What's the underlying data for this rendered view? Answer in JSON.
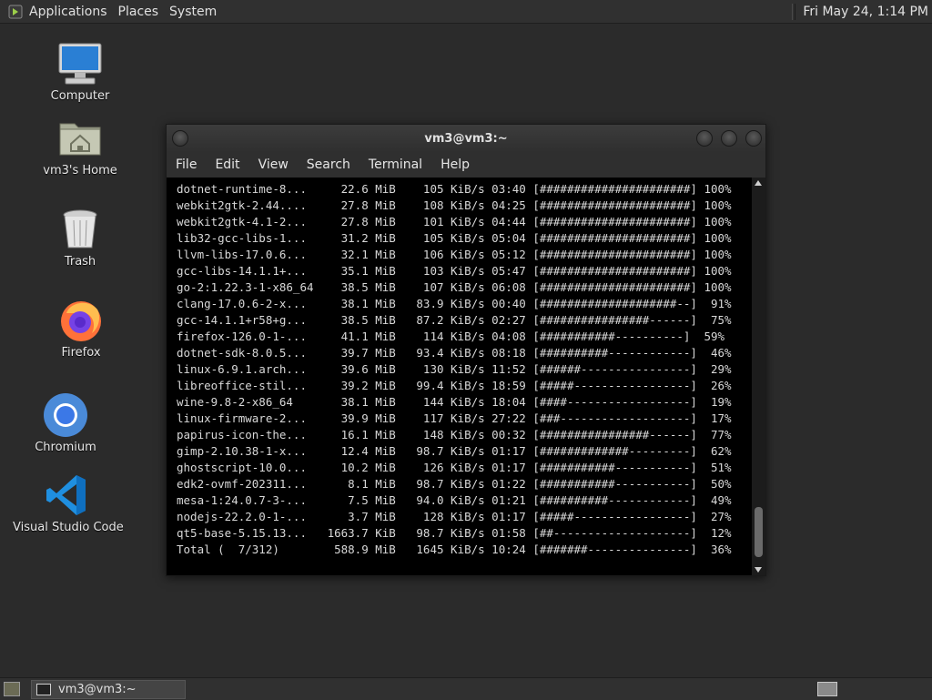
{
  "top_panel": {
    "menus": [
      "Applications",
      "Places",
      "System"
    ],
    "clock": "Fri May 24,  1:14 PM"
  },
  "desktop_icons": [
    {
      "label": "Computer",
      "icon": "computer-monitor-icon"
    },
    {
      "label": "vm3's Home",
      "icon": "home-folder-icon"
    },
    {
      "label": "Trash",
      "icon": "trash-icon"
    },
    {
      "label": "Firefox",
      "icon": "firefox-icon"
    },
    {
      "label": "Chromium",
      "icon": "chromium-icon"
    },
    {
      "label": "Visual Studio Code",
      "icon": "vscode-icon"
    }
  ],
  "window": {
    "title": "vm3@vm3:~",
    "menus": [
      "File",
      "Edit",
      "View",
      "Search",
      "Terminal",
      "Help"
    ]
  },
  "terminal_lines": [
    " dotnet-runtime-8...     22.6 MiB    105 KiB/s 03:40 [######################] 100%",
    " webkit2gtk-2.44....     27.8 MiB    108 KiB/s 04:25 [######################] 100%",
    " webkit2gtk-4.1-2...     27.8 MiB    101 KiB/s 04:44 [######################] 100%",
    " lib32-gcc-libs-1...     31.2 MiB    105 KiB/s 05:04 [######################] 100%",
    " llvm-libs-17.0.6...     32.1 MiB    106 KiB/s 05:12 [######################] 100%",
    " gcc-libs-14.1.1+...     35.1 MiB    103 KiB/s 05:47 [######################] 100%",
    " go-2:1.22.3-1-x86_64    38.5 MiB    107 KiB/s 06:08 [######################] 100%",
    " clang-17.0.6-2-x...     38.1 MiB   83.9 KiB/s 00:40 [####################--]  91%",
    " gcc-14.1.1+r58+g...     38.5 MiB   87.2 KiB/s 02:27 [################------]  75%",
    " firefox-126.0-1-...     41.1 MiB    114 KiB/s 04:08 [###########----------]  59%",
    " dotnet-sdk-8.0.5...     39.7 MiB   93.4 KiB/s 08:18 [##########------------]  46%",
    " linux-6.9.1.arch...     39.6 MiB    130 KiB/s 11:52 [######----------------]  29%",
    " libreoffice-stil...     39.2 MiB   99.4 KiB/s 18:59 [#####-----------------]  26%",
    " wine-9.8-2-x86_64       38.1 MiB    144 KiB/s 18:04 [####------------------]  19%",
    " linux-firmware-2...     39.9 MiB    117 KiB/s 27:22 [###-------------------]  17%",
    " papirus-icon-the...     16.1 MiB    148 KiB/s 00:32 [################------]  77%",
    " gimp-2.10.38-1-x...     12.4 MiB   98.7 KiB/s 01:17 [#############---------]  62%",
    " ghostscript-10.0...     10.2 MiB    126 KiB/s 01:17 [###########-----------]  51%",
    " edk2-ovmf-202311...      8.1 MiB   98.7 KiB/s 01:22 [###########-----------]  50%",
    " mesa-1:24.0.7-3-...      7.5 MiB   94.0 KiB/s 01:21 [##########------------]  49%",
    " nodejs-22.2.0-1-...      3.7 MiB    128 KiB/s 01:17 [#####-----------------]  27%",
    " qt5-base-5.15.13...   1663.7 KiB   98.7 KiB/s 01:58 [##--------------------]  12%",
    " Total (  7/312)        588.9 MiB   1645 KiB/s 10:24 [#######---------------]  36%"
  ],
  "taskbar": {
    "task_label": "vm3@vm3:~"
  }
}
